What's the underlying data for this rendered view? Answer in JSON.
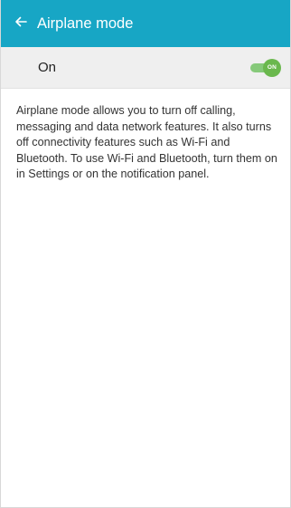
{
  "header": {
    "title": "Airplane mode",
    "back_icon": "arrow-left-icon"
  },
  "master_switch": {
    "label": "On",
    "state": "ON",
    "checked": true,
    "colors": {
      "track": "#86c97a",
      "thumb": "#6ab84d"
    }
  },
  "description": "Airplane mode allows you to turn off calling, messaging and data network features. It also turns off connectivity features such as Wi-Fi and Bluetooth. To use Wi-Fi and Bluetooth, turn them on in Settings or on the notification panel.",
  "colors": {
    "app_bar": "#17a6c5",
    "switch_bar": "#efefef"
  }
}
